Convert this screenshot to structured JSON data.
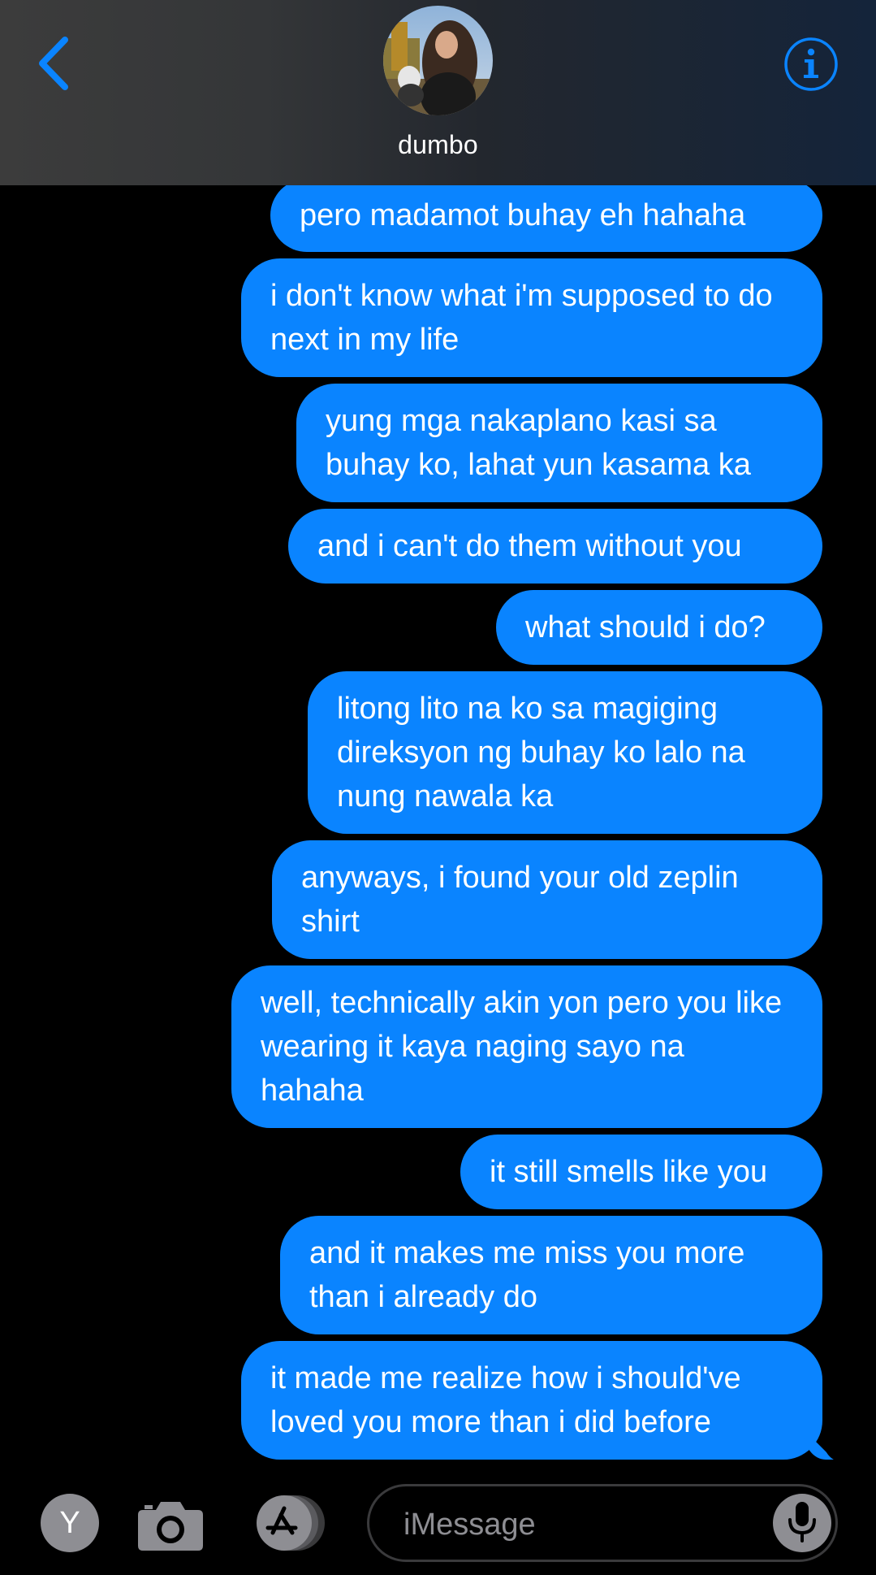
{
  "header": {
    "contact_name": "dumbo"
  },
  "messages": [
    {
      "text": "pero madamot buhay eh hahaha"
    },
    {
      "text": "i don't know what i'm supposed to do next in my life"
    },
    {
      "text": "yung mga nakaplano kasi sa buhay ko, lahat yun kasama ka"
    },
    {
      "text": "and i can't do them without you"
    },
    {
      "text": "what should i do?"
    },
    {
      "text": "litong lito na ko sa magiging direksyon ng buhay ko lalo na nung nawala ka"
    },
    {
      "text": "anyways, i found your old zeplin shirt"
    },
    {
      "text": "well, technically akin yon pero you like wearing it kaya naging sayo na hahaha"
    },
    {
      "text": "it still smells like you"
    },
    {
      "text": "and it makes me miss you more than i already do"
    },
    {
      "text": "it made me realize how i should've loved you more than i did before"
    }
  ],
  "input_bar": {
    "apps_label": "Y",
    "message_placeholder": "iMessage"
  },
  "colors": {
    "bubble_blue": "#0a84ff",
    "accent_blue": "#0a84ff",
    "background": "#000000",
    "icon_gray": "#8e8e93"
  },
  "icons": {
    "back": "chevron-left-icon",
    "info": "info-icon",
    "camera": "camera-icon",
    "appstore": "app-store-icon",
    "mic": "microphone-icon"
  }
}
